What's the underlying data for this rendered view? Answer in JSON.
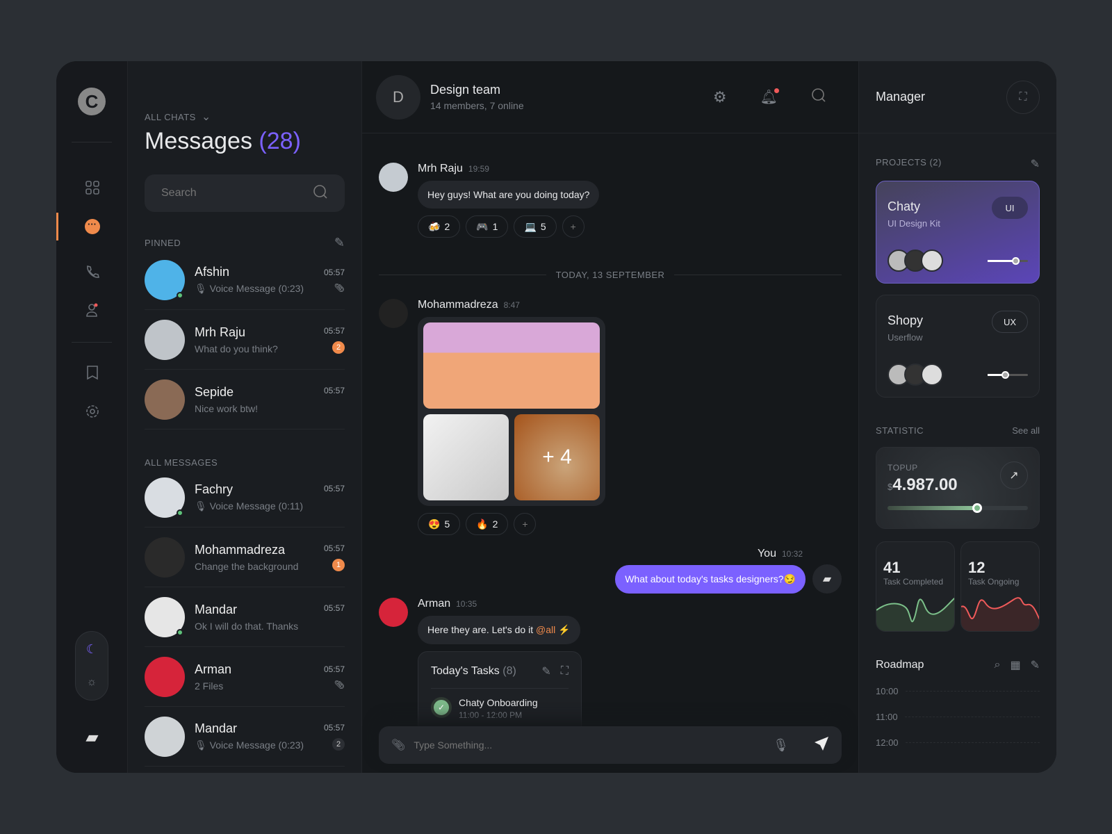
{
  "nav": {
    "items": [
      "dashboard-icon",
      "chat-icon",
      "phone-icon",
      "contacts-icon",
      "bookmark-icon",
      "settings-icon"
    ],
    "accent": "#f08a4b"
  },
  "list": {
    "filter": "ALL CHATS",
    "title": "Messages",
    "count": "(28)",
    "search_placeholder": "Search",
    "pinned_label": "PINNED",
    "all_label": "ALL MESSAGES",
    "pinned": [
      {
        "name": "Afshin",
        "sub": "Voice Message (0:23)",
        "time": "05:57",
        "voice": true,
        "attach": true,
        "online": true,
        "color": "#4fb3e8"
      },
      {
        "name": "Mrh Raju",
        "sub": "What do you think?",
        "time": "05:57",
        "badge": "2",
        "color": "#bfc4c9"
      },
      {
        "name": "Sepide",
        "sub": "Nice work btw!",
        "time": "05:57",
        "color": "#8a6a55"
      }
    ],
    "all": [
      {
        "name": "Fachry",
        "sub": "Voice Message (0:11)",
        "time": "05:57",
        "voice": true,
        "online": true,
        "color": "#d9dde2"
      },
      {
        "name": "Mohammadreza",
        "sub": "Change the background",
        "time": "05:57",
        "badge": "1",
        "color": "#2a2a2a"
      },
      {
        "name": "Mandar",
        "sub": "Ok I will do that. Thanks",
        "time": "05:57",
        "online": true,
        "color": "#e6e6e6"
      },
      {
        "name": "Arman",
        "sub": "2 Files",
        "time": "05:57",
        "attach": true,
        "color": "#d6243a"
      },
      {
        "name": "Mandar",
        "sub": "Voice Message (0:23)",
        "time": "05:57",
        "voice": true,
        "badge": "2",
        "badge_gray": true,
        "color": "#cfd3d6"
      }
    ]
  },
  "chat": {
    "initial": "D",
    "title": "Design team",
    "subtitle": "14 members, 7 online",
    "m1": {
      "name": "Mrh Raju",
      "time": "19:59",
      "text": "Hey guys! What are you doing today?",
      "reacts": [
        {
          "e": "🍻",
          "n": "2"
        },
        {
          "e": "🎮",
          "n": "1"
        },
        {
          "e": "💻",
          "n": "5"
        }
      ]
    },
    "divider": "TODAY, 13 SEPTEMBER",
    "m2": {
      "name": "Mohammadreza",
      "time": "8:47",
      "more": "+ 4",
      "reacts": [
        {
          "e": "😍",
          "n": "5"
        },
        {
          "e": "🔥",
          "n": "2"
        }
      ]
    },
    "m3": {
      "name": "You",
      "time": "10:32",
      "text": "What about today's tasks designers?😏"
    },
    "m4": {
      "name": "Arman",
      "time": "10:35",
      "text": "Here they are. Let's do it ",
      "mention": "@all",
      "emoji": "⚡"
    },
    "tasks": {
      "title": "Today's Tasks",
      "count": "(8)",
      "item": "Chaty Onboarding",
      "item_time": "11:00 - 12:00 PM"
    },
    "input_placeholder": "Type Something...",
    "accent": "#7b61ff"
  },
  "right": {
    "title": "Manager",
    "projects_label": "PROJECTS (2)",
    "projects": [
      {
        "name": "Chaty",
        "sub": "UI Design Kit",
        "tag": "UI",
        "progress": 70
      },
      {
        "name": "Shopy",
        "sub": "Userflow",
        "tag": "UX",
        "progress": 45
      }
    ],
    "stat_label": "STATISTIC",
    "see_all": "See all",
    "topup_label": "TOPUP",
    "currency": "$",
    "amount": "4.987.00",
    "topup_progress": 64,
    "completed": {
      "n": "41",
      "label": "Task Completed",
      "color": "#7cc08a"
    },
    "ongoing": {
      "n": "12",
      "label": "Task Ongoing",
      "color": "#f05a5a"
    },
    "roadmap": "Roadmap",
    "times": [
      "10:00",
      "11:00",
      "12:00"
    ]
  }
}
